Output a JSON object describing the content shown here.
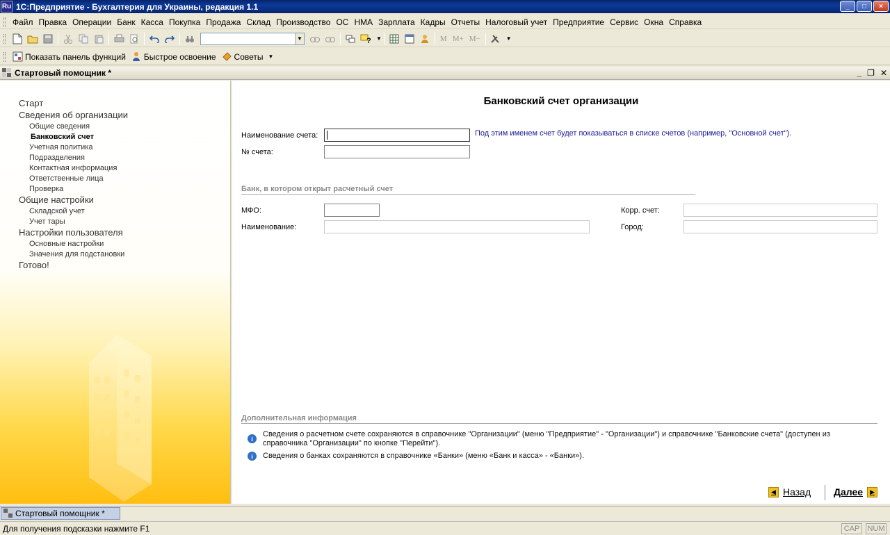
{
  "window": {
    "lang_icon": "Ru",
    "title": "1С:Предприятие - Бухгалтерия для Украины, редакция 1.1"
  },
  "menu": [
    "Файл",
    "Правка",
    "Операции",
    "Банк",
    "Касса",
    "Покупка",
    "Продажа",
    "Склад",
    "Производство",
    "ОС",
    "НМА",
    "Зарплата",
    "Кадры",
    "Отчеты",
    "Налоговый учет",
    "Предприятие",
    "Сервис",
    "Окна",
    "Справка"
  ],
  "toolbar1": {
    "m_buttons": [
      "M",
      "M+",
      "M−"
    ],
    "search_value": ""
  },
  "toolbar2": {
    "show_panel": "Показать панель функций",
    "quick": "Быстрое освоение",
    "tips": "Советы"
  },
  "child": {
    "title": "Стартовый помощник *"
  },
  "steps": {
    "start": "Старт",
    "org": "Сведения об организации",
    "org_items": [
      "Общие сведения",
      "Банковский счет",
      "Учетная политика",
      "Подразделения",
      "Контактная информация",
      "Ответственные лица",
      "Проверка"
    ],
    "general": "Общие настройки",
    "general_items": [
      "Складской учет",
      "Учет тары"
    ],
    "user": "Настройки пользователя",
    "user_items": [
      "Основные настройки",
      "Значения для подстановки"
    ],
    "done": "Готово!"
  },
  "form": {
    "heading": "Банковский счет организации",
    "account_name_label": "Наименование счета:",
    "account_name_value": "",
    "account_name_hint": "Под этим именем счет будет показываться в списке счетов (например, \"Основной счет\").",
    "account_no_label": "№ счета:",
    "account_no_value": "",
    "bank_group": "Банк, в котором открыт расчетный счет",
    "mfo_label": "МФО:",
    "mfo_value": "",
    "bank_name_label": "Наименование:",
    "bank_name_value": "",
    "corr_label": "Корр. счет:",
    "corr_value": "",
    "city_label": "Город:",
    "city_value": "",
    "info_title": "Дополнительная информация",
    "info1": "Сведения о расчетном счете сохраняются в справочнике \"Организации\" (меню \"Предприятие\" - \"Организации\") и справочнике \"Банковские счета\" (доступен из справочника \"Организации\" по кнопке \"Перейти\").",
    "info2": "Сведения о банках сохраняются в справочнике «Банки» (меню «Банк и касса» - «Банки»).",
    "back": "Назад",
    "next": "Далее"
  },
  "taskbar": {
    "item": "Стартовый помощник *"
  },
  "status": {
    "text": "Для получения подсказки нажмите F1",
    "cap": "CAP",
    "num": "NUM"
  },
  "colors": {
    "title_bg": "#0a246a",
    "accent_yellow": "#ffbe10",
    "hint_blue": "#1a1a9a"
  }
}
